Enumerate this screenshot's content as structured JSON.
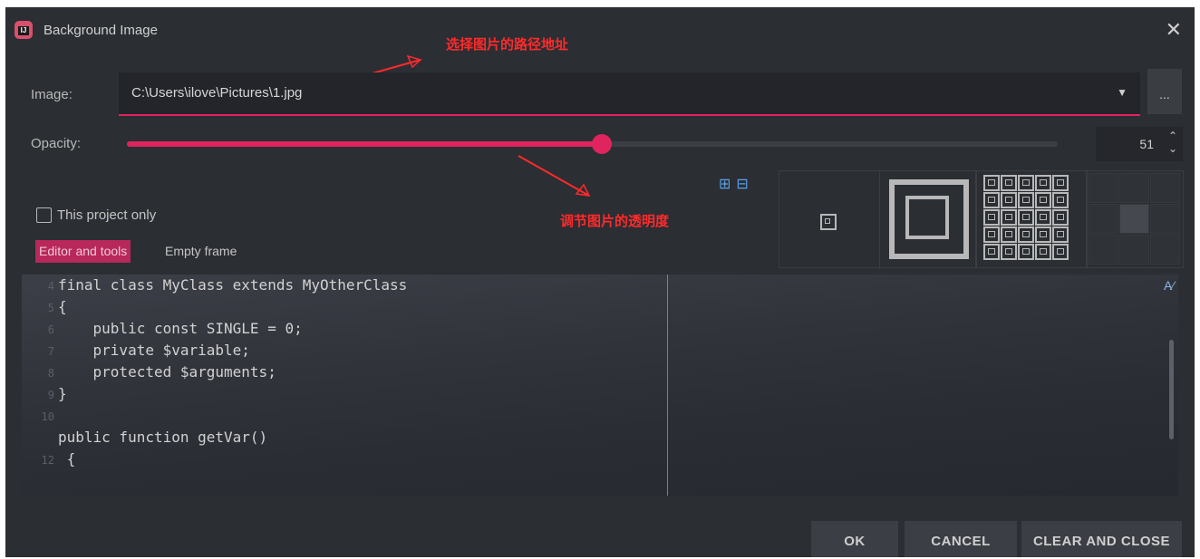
{
  "dialog": {
    "title": "Background Image",
    "close_icon": "close-icon",
    "app_icon": "ide-logo-icon"
  },
  "annotations": {
    "path_note": "选择图片的路径地址",
    "opacity_note": "调节图片的透明度",
    "color": "#ff2a2a"
  },
  "image": {
    "label": "Image:",
    "value": "C:\\Users\\ilove\\Pictures\\1.jpg",
    "browse_label": "...",
    "dropdown_icon": "chevron-down-icon"
  },
  "opacity": {
    "label": "Opacity:",
    "value": "51",
    "fraction": 0.51
  },
  "project_only": {
    "label": "This project only",
    "checked": false
  },
  "tabs": [
    {
      "label": "Editor and tools",
      "active": true
    },
    {
      "label": "Empty frame",
      "active": false
    }
  ],
  "code_lines": [
    {
      "num": "4",
      "text": "final class MyClass extends MyOtherClass"
    },
    {
      "num": "5",
      "text": "{"
    },
    {
      "num": "6",
      "text": "    public const SINGLE = 0;"
    },
    {
      "num": "7",
      "text": "    private $variable;"
    },
    {
      "num": "8",
      "text": "    protected $arguments;"
    },
    {
      "num": "9",
      "text": "}"
    },
    {
      "num": "10",
      "text": ""
    },
    {
      "num": "",
      "text": "public function getVar()"
    },
    {
      "num": "12",
      "text": " {"
    }
  ],
  "buttons": {
    "ok": "OK",
    "cancel": "CANCEL",
    "clear": "CLEAR AND CLOSE"
  },
  "colors": {
    "accent": "#e0245e",
    "background": "#2b2e33"
  }
}
